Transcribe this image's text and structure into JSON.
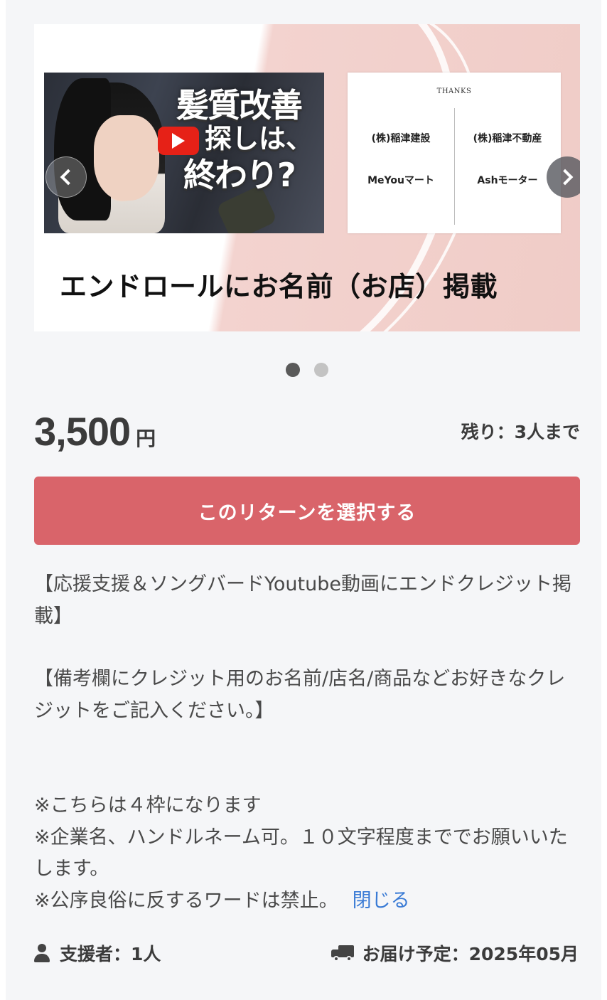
{
  "carousel": {
    "slides": [
      {
        "video_thumb_text": [
          "髪質改善",
          "探しは、",
          "終わり?"
        ],
        "thanks_title": "THANKS",
        "thanks_names": [
          "(株)稲津建設",
          "(株)稲津不動産",
          "MeYouマート",
          "Ashモーター"
        ],
        "caption": "エンドロールにお名前（お店）掲載"
      }
    ],
    "prev_icon": "chevron-left-icon",
    "next_icon": "chevron-right-icon",
    "dots_count": 2,
    "active_dot": 0
  },
  "price": {
    "amount": "3,500",
    "unit": "円"
  },
  "remaining": "残り：3人まで",
  "select_button": {
    "label": "このリターンを選択する",
    "color": "#d9646a"
  },
  "description": {
    "paragraphs": [
      "【応援支援＆ソングバードYoutube動画にエンドクレジット掲載】",
      "【備考欄にクレジット用のお名前/店名/商品などお好きなクレジットをご記入ください。】",
      "※こちらは４枠になります\n※企業名、ハンドルネーム可。１０文字程度まででお願いいたします。\n※公序良俗に反するワードは禁止。"
    ],
    "close_link": "閉じる",
    "link_color": "#3a7bd5"
  },
  "footer": {
    "supporters_icon": "user-icon",
    "supporters": "支援者：1人",
    "delivery_icon": "truck-icon",
    "delivery": "お届け予定：2025年05月"
  }
}
